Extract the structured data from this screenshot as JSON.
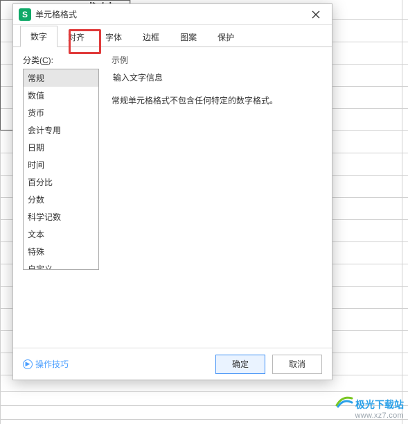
{
  "background": {
    "visible_text": "口成绩"
  },
  "dialog": {
    "title": "单元格格式",
    "app_icon_letter": "S",
    "tabs": [
      {
        "label": "数字",
        "active": true
      },
      {
        "label": "对齐",
        "active": false
      },
      {
        "label": "字体",
        "active": false
      },
      {
        "label": "边框",
        "active": false
      },
      {
        "label": "图案",
        "active": false
      },
      {
        "label": "保护",
        "active": false
      }
    ],
    "category_label_prefix": "分类(",
    "category_label_key": "C",
    "category_label_suffix": "):",
    "categories": [
      "常规",
      "数值",
      "货币",
      "会计专用",
      "日期",
      "时间",
      "百分比",
      "分数",
      "科学记数",
      "文本",
      "特殊",
      "自定义"
    ],
    "selected_category_index": 0,
    "sample_label": "示例",
    "sample_value": "输入文字信息",
    "description": "常规单元格格式不包含任何特定的数字格式。",
    "tips_label": "操作技巧",
    "ok_label": "确定",
    "cancel_label": "取消"
  },
  "watermark": {
    "title": "极光下载站",
    "url": "www.xz7.com"
  }
}
